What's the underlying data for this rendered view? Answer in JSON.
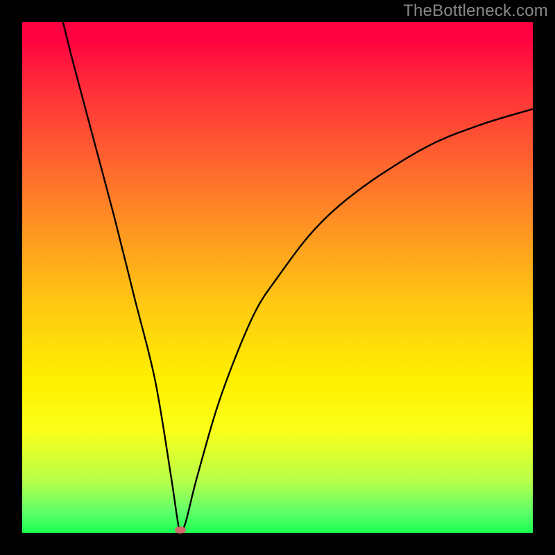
{
  "watermark": "TheBottleneck.com",
  "colors": {
    "frame": "#000000",
    "curve": "#000000",
    "dot": "#d36a6a",
    "gradient_top": "#ff0040",
    "gradient_bottom": "#1aff50"
  },
  "chart_data": {
    "type": "line",
    "title": "",
    "xlabel": "",
    "ylabel": "",
    "xlim": [
      0,
      100
    ],
    "ylim": [
      0,
      100
    ],
    "series": [
      {
        "name": "curve",
        "x": [
          8,
          10,
          14,
          18,
          22,
          26,
          29,
          30.5,
          31,
          32,
          34,
          38,
          42,
          46,
          50,
          56,
          62,
          70,
          80,
          90,
          100
        ],
        "y": [
          100,
          92,
          77,
          62,
          46,
          30,
          12,
          2,
          0.5,
          2,
          10,
          24,
          35,
          44,
          50,
          58,
          64,
          70,
          76,
          80,
          83
        ]
      }
    ],
    "marker": {
      "x": 31,
      "y": 0.5
    },
    "annotations": []
  }
}
